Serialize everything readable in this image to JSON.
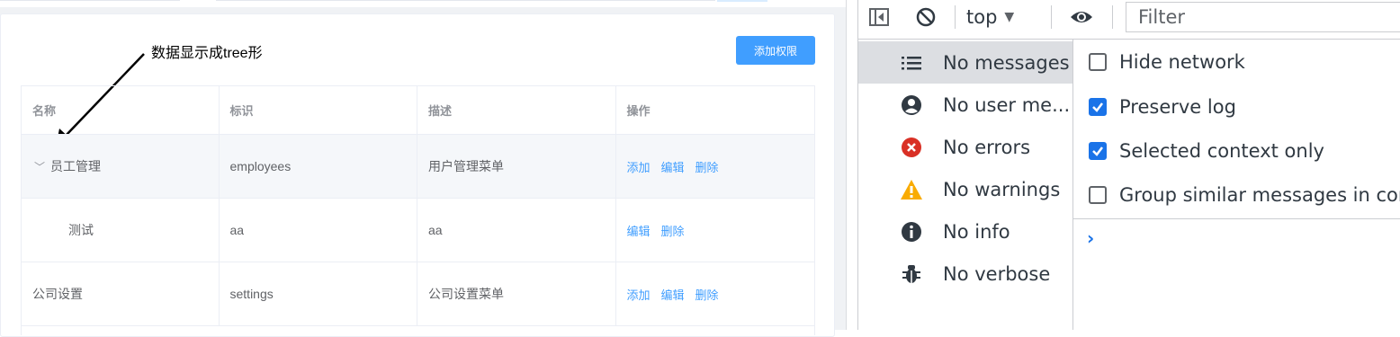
{
  "admin": {
    "annotation": "数据显示成tree形",
    "add_button": "添加权限",
    "columns": [
      "名称",
      "标识",
      "描述",
      "操作"
    ],
    "rows": [
      {
        "name": "员工管理",
        "code": "employees",
        "desc": "用户管理菜单",
        "actions": [
          "添加",
          "编辑",
          "删除"
        ],
        "expanded": true,
        "level": 0
      },
      {
        "name": "测试",
        "code": "aa",
        "desc": "aa",
        "actions": [
          "编辑",
          "删除"
        ],
        "level": 1
      },
      {
        "name": "公司设置",
        "code": "settings",
        "desc": "公司设置菜单",
        "actions": [
          "添加",
          "编辑",
          "删除"
        ],
        "level": 0
      }
    ]
  },
  "devtools": {
    "toolbar": {
      "sidebar_toggle_icon": "sidebar-toggle-icon",
      "clear_icon": "clear-console-icon",
      "context": "top",
      "eye_icon": "live-expression-icon",
      "filter_placeholder": "Filter"
    },
    "sidebar": [
      {
        "label": "No messages",
        "icon": "list-icon",
        "selected": true
      },
      {
        "label": "No user me...",
        "icon": "user-icon"
      },
      {
        "label": "No errors",
        "icon": "error-icon"
      },
      {
        "label": "No warnings",
        "icon": "warning-icon"
      },
      {
        "label": "No info",
        "icon": "info-icon"
      },
      {
        "label": "No verbose",
        "icon": "bug-icon"
      }
    ],
    "settings": [
      {
        "label": "Hide network",
        "checked": false
      },
      {
        "label": "Preserve log",
        "checked": true
      },
      {
        "label": "Selected context only",
        "checked": true
      },
      {
        "label": "Group similar messages in con",
        "checked": false
      }
    ],
    "prompt": "›",
    "colors": {
      "accent": "#1a73e8",
      "error": "#d93025",
      "warning": "#f9ab00",
      "link": "#409eff",
      "primary_button": "#409eff"
    }
  }
}
